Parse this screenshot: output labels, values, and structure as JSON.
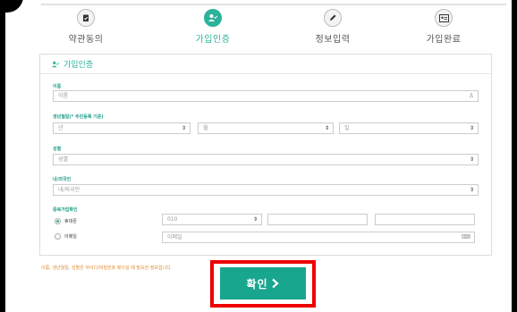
{
  "steps": [
    {
      "label": "약관동의",
      "icon": "clipboard-check-icon",
      "active": false
    },
    {
      "label": "가입인증",
      "icon": "user-check-icon",
      "active": true
    },
    {
      "label": "정보입력",
      "icon": "pencil-icon",
      "active": false
    },
    {
      "label": "가입완료",
      "icon": "id-card-icon",
      "active": false
    }
  ],
  "card": {
    "title": "가입인증"
  },
  "form": {
    "name": {
      "label": "이름",
      "placeholder": "이름"
    },
    "birth": {
      "label": "생년월일(* 주민등록 기준)",
      "year": "년",
      "month": "월",
      "day": "일"
    },
    "gender": {
      "label": "성별",
      "value": "성별"
    },
    "nationality": {
      "label": "내/외국인",
      "value": "내/외국인"
    },
    "dup_check": {
      "label": "중복가입확인",
      "phone_option": "휴대폰",
      "email_option": "이메일",
      "phone_prefix": "010",
      "email_placeholder": "이메일"
    }
  },
  "note": "이름, 생년월일, 성별은 아이디/비밀번호 찾으실 때 필요한 정보입니다.",
  "confirm_label": "확인",
  "colors": {
    "accent": "#2bb39a",
    "button": "#19a68e",
    "highlight": "#ee0000",
    "note": "#e08a2c"
  }
}
